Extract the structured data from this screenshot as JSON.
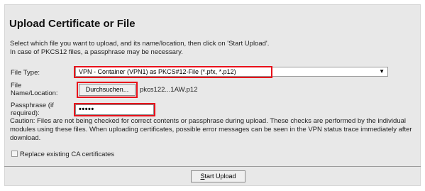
{
  "title": "Upload Certificate or File",
  "intro": {
    "line1": "Select which file you want to upload, and its name/location, then click on 'Start Upload'.",
    "line2": "In case of PKCS12 files, a passphrase may be necessary."
  },
  "file_type": {
    "label": "File Type:",
    "value": "VPN - Container (VPN1) as PKCS#12-File (*.pfx, *.p12)"
  },
  "file_location": {
    "label_line1": "File",
    "label_line2": "Name/Location:",
    "browse_label": "Durchsuchen...",
    "filename": "pkcs122...1AW.p12"
  },
  "passphrase": {
    "label_line1": "Passphrase (if",
    "label_line2": "required):",
    "value": "•••••"
  },
  "caution": "Caution: Files are not being checked for correct contents or passphrase during upload. These checks are performed by the individual modules using these files. When uploading certificates, possible error messages can be seen in the VPN status trace immediately after download.",
  "replace_ca": {
    "label": "Replace existing CA certificates",
    "checked": false
  },
  "start_upload_label": "Start Upload",
  "icons": {
    "dropdown": "chevron-down-icon"
  },
  "colors": {
    "highlight": "#e8101a",
    "panel": "#e8e8e8"
  }
}
